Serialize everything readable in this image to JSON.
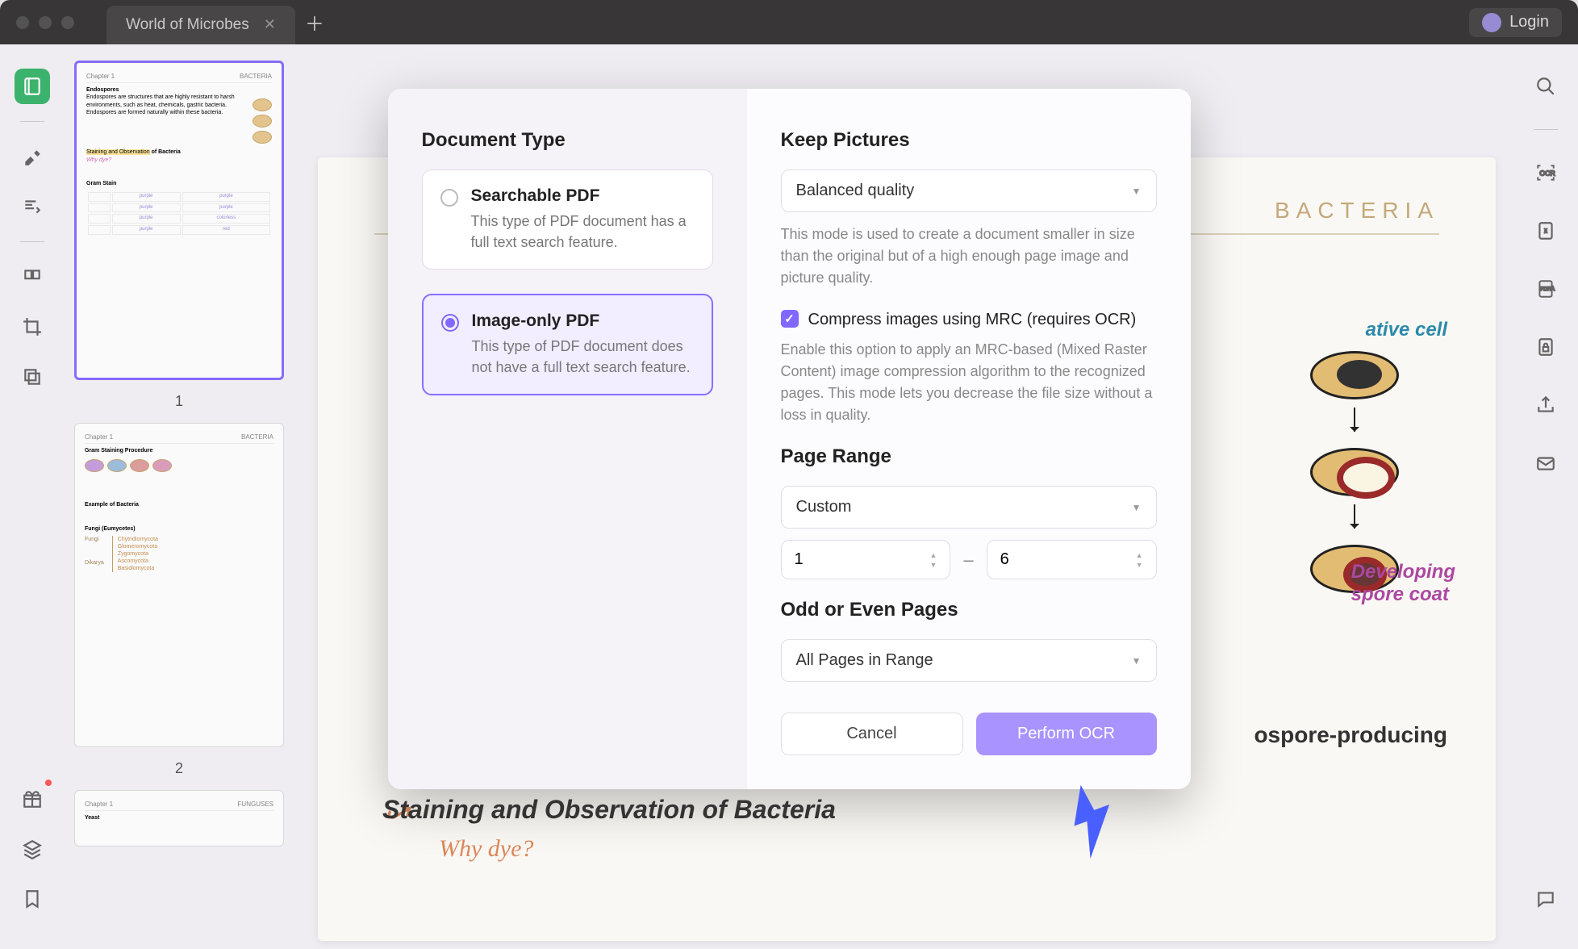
{
  "tab": {
    "title": "World of Microbes"
  },
  "login": {
    "label": "Login"
  },
  "thumbnails": {
    "page1": "1",
    "page2": "2"
  },
  "doc": {
    "header": "BACTERIA",
    "vegCell": "ative cell",
    "sporeCoat": "Developing\nspore coat",
    "ospore": "ospore-producing",
    "stainingLine": "Staining and Observation of Bacteria",
    "whyDye": "Why dye?"
  },
  "modal": {
    "docTypeTitle": "Document Type",
    "opt1": {
      "title": "Searchable PDF",
      "desc": "This type of PDF document has a full text search feature."
    },
    "opt2": {
      "title": "Image-only PDF",
      "desc": "This type of PDF document does not have a full text search feature."
    },
    "keepPicturesTitle": "Keep Pictures",
    "qualitySelect": "Balanced quality",
    "qualityHelp": "This mode is used to create a document smaller in size than the original but of a high enough page image and picture quality.",
    "mrcLabel": "Compress images using MRC (requires OCR)",
    "mrcHelp": "Enable this option to apply an MRC-based (Mixed Raster Content) image compression algorithm to the recognized pages. This mode lets you decrease the file size without a loss in quality.",
    "pageRangeTitle": "Page Range",
    "rangeSelect": "Custom",
    "rangeFrom": "1",
    "rangeTo": "6",
    "rangeDash": "–",
    "oddEvenTitle": "Odd or Even Pages",
    "oddEvenSelect": "All Pages in Range",
    "cancel": "Cancel",
    "confirm": "Perform OCR"
  },
  "thumbContent": {
    "chapter": "Chapter 1",
    "bacteria": "BACTERIA",
    "endospores": "Endospores",
    "endoText": "Endospores are structures that are highly resistant to harsh environments, such as heat, chemicals, gastric bacteria. Endospores are formed naturally within these bacteria.",
    "stainingHL": "Staining and Observation",
    "ofBacteria": "of Bacteria",
    "whyDye": "Why dye?",
    "gramStain": "Gram Stain",
    "gramProc": "Gram Staining Procedure",
    "example": "Example of Bacteria",
    "fungi": "Fungi  (Eumycetes)",
    "fungiBranch": [
      "Chytridiomycota",
      "Glomeromycota",
      "Zygomycota",
      "Ascomycota",
      "Basidiomycota"
    ],
    "fungiLeft": [
      "Fungi",
      "Dikarya"
    ],
    "yeast": "Yeast",
    "funguses": "FUNGUSES"
  }
}
